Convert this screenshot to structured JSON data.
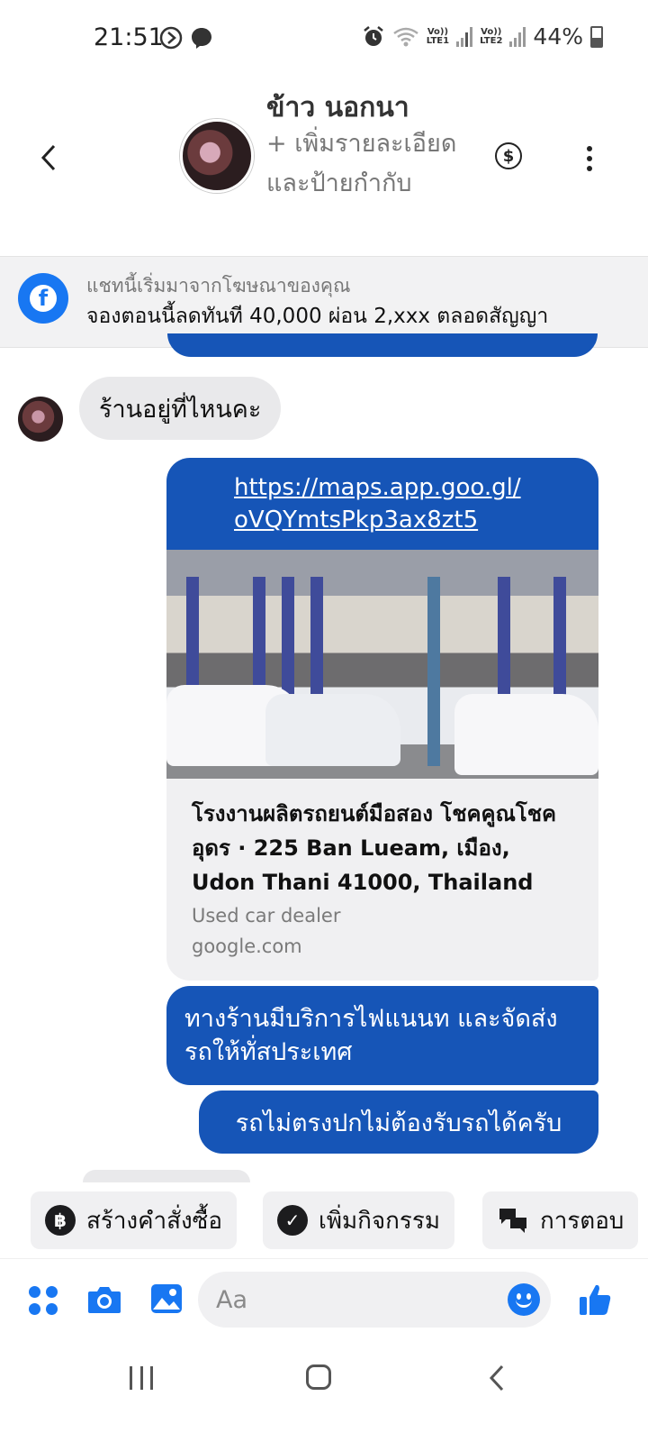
{
  "status_bar": {
    "time": "21:51",
    "battery": "44%",
    "sim1": "Vo))\nLTE1",
    "sim2": "Vo))\nLTE2"
  },
  "header": {
    "contact_name": "ข้าว นอกนา",
    "add_details": "+ เพิ่มรายละเอียดและป้ายกำกับ"
  },
  "ad_banner": {
    "line1": "แชทนี้เริ่มมาจากโฆษณาของคุณ",
    "line2": "จองตอนนี้ลดทันที 40,000 ผ่อน 2,xxx ตลอดสัญญา"
  },
  "messages": {
    "incoming_1": "ร้านอยู่ที่ไหนคะ",
    "link_url": "https://maps.app.goo.gl/oVQYmtsPkp3ax8zt5",
    "link_title": "โรงงานผลิตรถยนต์มือสอง โชคคูณโชคอุดร · 225 Ban Lueam, เมือง, Udon Thani 41000, Thailand",
    "link_category": "Used car dealer",
    "link_domain": "google.com",
    "outgoing_1": "ทางร้านมีบริการไฟแนนท และจัดส่งรถให้ทั่สประเทศ",
    "outgoing_2": "รถไม่ตรงปกไม่ต้องรับรถได้ครับ"
  },
  "quick_actions": {
    "create_order": "สร้างคำสั่งซื้อ",
    "add_activity": "เพิ่มกิจกรรม",
    "replies": "การตอบ"
  },
  "composer": {
    "placeholder": "Aa"
  },
  "colors": {
    "outgoing_bubble": "#1655b7",
    "messenger_blue": "#1877f2",
    "incoming_bubble": "#e9e9eb"
  }
}
